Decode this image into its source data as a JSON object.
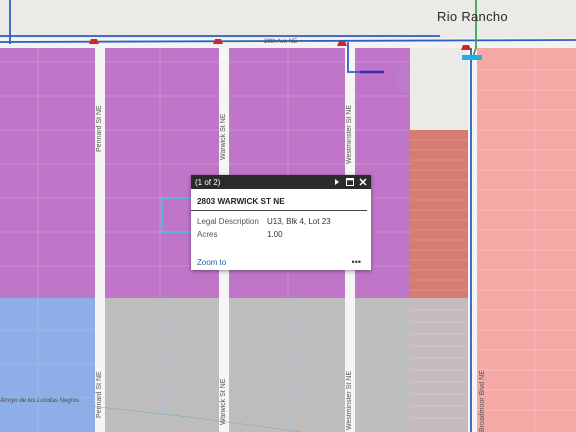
{
  "map": {
    "city_label": "Rio Rancho",
    "road_label": "28th Ave NE",
    "streets": [
      {
        "id": "pennard",
        "label": "Pennard St NE"
      },
      {
        "id": "warwick",
        "label": "Warwick St NE"
      },
      {
        "id": "westminster",
        "label": "Westminster St NE"
      },
      {
        "id": "broadmoor",
        "label": "Broadmoor Blvd NE"
      }
    ],
    "arroyo_label": "Arroyo de los Lomitas Negros",
    "colors": {
      "purple_parcel": "#bf76c9",
      "gray_parcel": "#bdbdbd",
      "blue_parcel": "#8eaee8",
      "pink_parcel": "#f4a9a6",
      "red_parcel": "#d67d72",
      "road": "#f5f5f5",
      "highway_blue": "#2c5fbe",
      "green_line": "#3fa34d",
      "marker": "#d12626"
    }
  },
  "popup": {
    "counter": "(1 of 2)",
    "title": "2803 WARWICK ST NE",
    "fields": [
      {
        "label": "Legal Description",
        "value": "U13, Blk 4, Lot 23"
      },
      {
        "label": "Acres",
        "value": "1.00"
      }
    ],
    "zoom_label": "Zoom to",
    "more_label": "•••"
  }
}
